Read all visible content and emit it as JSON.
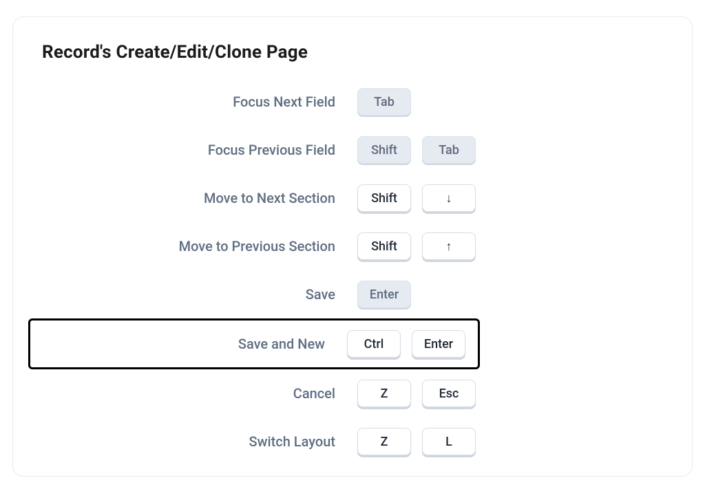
{
  "card": {
    "title": "Record's Create/Edit/Clone Page",
    "rows": {
      "focus_next_field": {
        "label": "Focus Next Field",
        "keys": [
          {
            "text": "Tab",
            "style": "flat",
            "tone": "light"
          }
        ]
      },
      "focus_previous_field": {
        "label": "Focus Previous Field",
        "keys": [
          {
            "text": "Shift",
            "style": "flat",
            "tone": "light"
          },
          {
            "text": "Tab",
            "style": "flat",
            "tone": "light"
          }
        ]
      },
      "move_next_section": {
        "label": "Move to Next Section",
        "keys": [
          {
            "text": "Shift",
            "style": "raised",
            "tone": "dark"
          },
          {
            "text": "↓",
            "style": "raised",
            "tone": "dark"
          }
        ]
      },
      "move_previous_section": {
        "label": "Move to Previous Section",
        "keys": [
          {
            "text": "Shift",
            "style": "raised",
            "tone": "dark"
          },
          {
            "text": "↑",
            "style": "raised",
            "tone": "dark"
          }
        ]
      },
      "save": {
        "label": "Save",
        "keys": [
          {
            "text": "Enter",
            "style": "flat",
            "tone": "light"
          }
        ]
      },
      "save_and_new": {
        "label": "Save and New",
        "keys": [
          {
            "text": "Ctrl",
            "style": "raised",
            "tone": "dark"
          },
          {
            "text": "Enter",
            "style": "raised",
            "tone": "dark"
          }
        ],
        "highlighted": true
      },
      "cancel": {
        "label": "Cancel",
        "keys": [
          {
            "text": "Z",
            "style": "raised",
            "tone": "dark"
          },
          {
            "text": "Esc",
            "style": "raised",
            "tone": "dark"
          }
        ]
      },
      "switch_layout": {
        "label": "Switch Layout",
        "keys": [
          {
            "text": "Z",
            "style": "raised",
            "tone": "dark"
          },
          {
            "text": "L",
            "style": "raised",
            "tone": "dark"
          }
        ]
      }
    }
  }
}
